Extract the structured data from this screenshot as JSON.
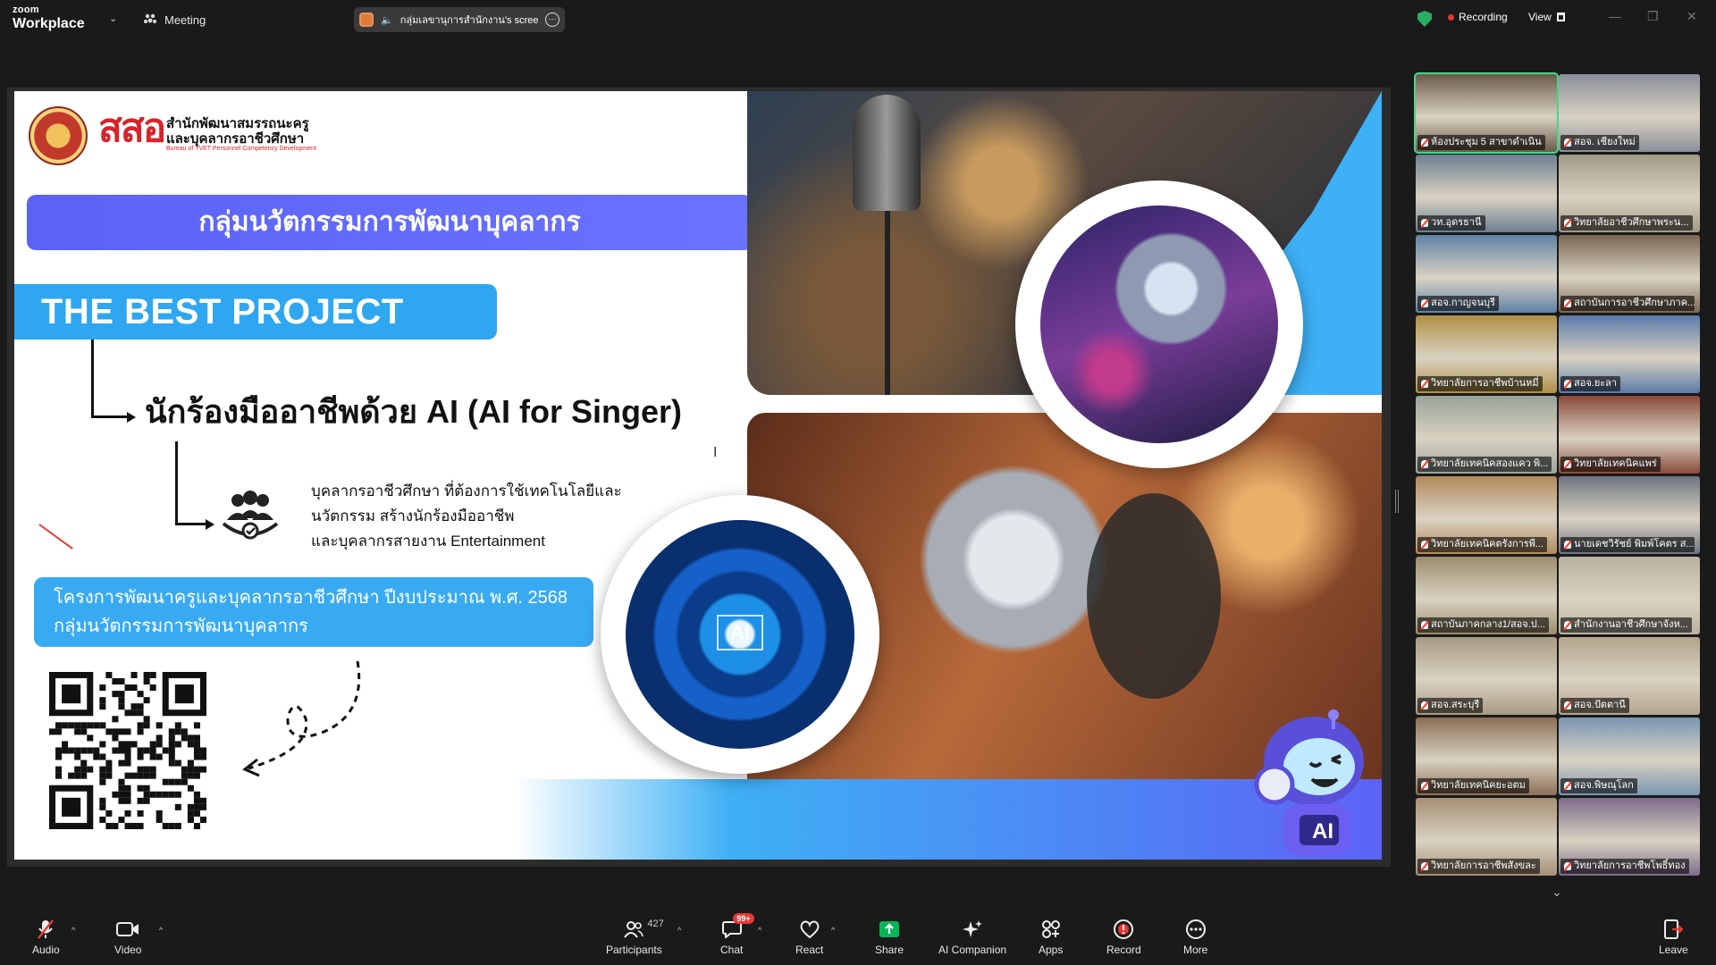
{
  "topbar": {
    "brand_small": "zoom",
    "brand": "Workplace",
    "meeting_label": "Meeting",
    "share_name": "กลุ่มเลขานุการสำนักงาน's screen",
    "recording_label": "Recording",
    "view_label": "View"
  },
  "slide": {
    "org_abbr": "สสอ",
    "org_name_1": "สำนักพัฒนาสมรรถนะครู",
    "org_name_2": "และบุคลากรอาชีวศึกษา",
    "org_name_en": "Bureau of TVET Personnel Competency Development",
    "group_title": "กลุ่มนวัตกรรมการพัฒนาบุคลากร",
    "best_project": "THE BEST PROJECT",
    "project_title": "นักร้องมืออาชีพด้วย AI (AI for Singer)",
    "target_line_1": "บุคลากรอาชีวศึกษา ที่ต้องการใช้เทคโนโลยีและ",
    "target_line_2": "นวัตกรรม สร้างนักร้องมืออาชีพ",
    "target_line_3": "และบุคลากรสายงาน Entertainment",
    "program_line_1": "โครงการพัฒนาครูและบุคลากรอาชีวศึกษา ปีงบประมาณ พ.ศ. 2568",
    "program_line_2": "กลุ่มนวัตกรรมการพัฒนาบุคลากร",
    "ai_chip": "AI",
    "mascot_label": "AI"
  },
  "gallery": {
    "tiles": [
      {
        "label": "ห้องประชุม 5 สาขาดำเนิน",
        "scene": "#6b5a4a"
      },
      {
        "label": "สอจ. เชียงใหม่",
        "scene": "#8a8f99"
      },
      {
        "label": "วท.อุดรธานี",
        "scene": "#6c7f91"
      },
      {
        "label": "วิทยาลัยอาชีวศึกษาพระน...",
        "scene": "#a09a86"
      },
      {
        "label": "สอจ.กาญจนบุรี",
        "scene": "#5f83a6"
      },
      {
        "label": "สถาบันการอาชีวศึกษาภาค...",
        "scene": "#7a6652"
      },
      {
        "label": "วิทยาลัยการอาชีพบ้านหมี่",
        "scene": "#b09046"
      },
      {
        "label": "สอจ.ยะลา",
        "scene": "#5c7aa8"
      },
      {
        "label": "วิทยาลัยเทคนิคสองแคว พิ...",
        "scene": "#9aa39a"
      },
      {
        "label": "วิทยาลัยเทคนิคแพร่",
        "scene": "#8a4a3a"
      },
      {
        "label": "วิทยาลัยเทคนิคตรังการพี...",
        "scene": "#b28a5a"
      },
      {
        "label": "นายเดชวิรัชย์ พิมพ์โคตร ส...",
        "scene": "#6e7580"
      },
      {
        "label": "สถาบันภาคกลาง1/สอจ.ป...",
        "scene": "#9c8d6c"
      },
      {
        "label": "สำนักงานอาชีวศึกษาจังห...",
        "scene": "#b9b2a0"
      },
      {
        "label": "สอจ.สระบุรี",
        "scene": "#a79a82"
      },
      {
        "label": "สอจ.ปัตตานี",
        "scene": "#b3a58d"
      },
      {
        "label": "วิทยาลัยเทคนิคยะอตม",
        "scene": "#8c6e55"
      },
      {
        "label": "สอจ.พิษณุโลก",
        "scene": "#7a96b2"
      },
      {
        "label": "วิทยาลัยการอาชีพสังขละ",
        "scene": "#a58f74"
      },
      {
        "label": "วิทยาลัยการอาชีพโพธิ์ทอง",
        "scene": "#7d6b8a"
      }
    ]
  },
  "toolbar": {
    "audio": "Audio",
    "video": "Video",
    "participants": "Participants",
    "participant_count": "427",
    "chat": "Chat",
    "chat_badge": "99+",
    "react": "React",
    "share": "Share",
    "companion": "AI Companion",
    "apps": "Apps",
    "record": "Record",
    "more": "More",
    "leave": "Leave"
  },
  "colors": {
    "accent_green": "#27ae60",
    "share_green": "#0ab45a",
    "record_red": "#e53935",
    "slide_purple": "#5b63f5",
    "slide_blue": "#2fa6f0"
  }
}
